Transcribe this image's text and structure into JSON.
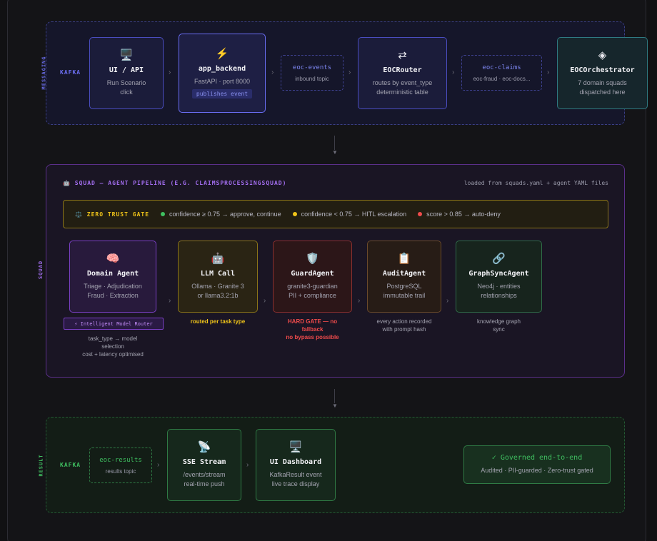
{
  "sections": {
    "messaging_label": "MESSAGING",
    "squad_label": "SQUAD",
    "result_label": "RESULT",
    "kafka_top": "KAFKA",
    "kafka_bottom": "KAFKA"
  },
  "messaging": {
    "ui_api": {
      "icon": "🖥️",
      "title": "UI / API",
      "sub1": "Run Scenario",
      "sub2": "click"
    },
    "backend": {
      "icon": "⚡",
      "title": "app_backend",
      "sub": "FastAPI · port 8000",
      "badge": "publishes event"
    },
    "eoc_events": {
      "title": "eoc-events",
      "sub": "inbound topic"
    },
    "router": {
      "icon": "⇄",
      "title": "EOCRouter",
      "sub1": "routes by event_type",
      "sub2": "deterministic table"
    },
    "eoc_claims": {
      "title": "eoc-claims",
      "sub": "eoc-fraud · eoc-docs..."
    },
    "orchestrator": {
      "icon": "◈",
      "title": "EOCOrchestrator",
      "sub1": "7 domain squads",
      "sub2": "dispatched here"
    }
  },
  "squad": {
    "title": "🤖 SQUAD — AGENT PIPELINE (E.G. CLAIMSPROCESSINGSQUAD)",
    "loaded_from": "loaded from squads.yaml + agent YAML files",
    "gate": {
      "title": "⚖️ ZERO TRUST GATE",
      "c1": "confidence ≥ 0.75 → approve, continue",
      "c2": "confidence < 0.75 → HITL escalation",
      "c3": "score > 0.85 → auto-deny"
    },
    "domain": {
      "icon": "🧠",
      "title": "Domain Agent",
      "sub1": "Triage · Adjudication",
      "sub2": "Fraud · Extraction"
    },
    "llm": {
      "icon": "🤖",
      "title": "LLM Call",
      "sub1": "Ollama · Granite 3",
      "sub2": "or llama3.2:1b"
    },
    "guard": {
      "icon": "🛡️",
      "title": "GuardAgent",
      "sub1": "granite3-guardian",
      "sub2": "PII + compliance"
    },
    "audit": {
      "icon": "📋",
      "title": "AuditAgent",
      "sub1": "PostgreSQL",
      "sub2": "immutable trail"
    },
    "graph": {
      "icon": "🔗",
      "title": "GraphSyncAgent",
      "sub1": "Neo4j · entities",
      "sub2": "relationships"
    },
    "router_badge": "⚡ Intelligent Model Router",
    "router_note1": "task_type → model",
    "router_note2": "selection",
    "router_note3": "cost + latency optimised",
    "llm_note": "routed per task type",
    "guard_note1": "HARD GATE — no",
    "guard_note2": "fallback",
    "guard_note3": "no bypass possible",
    "audit_note1": "every action recorded",
    "audit_note2": "with prompt hash",
    "graph_note1": "knowledge graph",
    "graph_note2": "sync"
  },
  "result": {
    "eoc_results": {
      "title": "eoc-results",
      "sub": "results topic"
    },
    "sse": {
      "icon": "📡",
      "title": "SSE Stream",
      "sub1": "/events/stream",
      "sub2": "real-time push"
    },
    "dashboard": {
      "icon": "🖥️",
      "title": "UI Dashboard",
      "sub1": "KafkaResult event",
      "sub2": "live trace display"
    },
    "governed": {
      "title": "✓ Governed end-to-end",
      "sub": "Audited · PII-guarded · Zero-trust gated"
    }
  },
  "colors": {
    "messaging": "#6b6ef0",
    "squad": "#a36ef0",
    "gate": "#f0c419",
    "result": "#3fbf60",
    "danger": "#f04b4b"
  }
}
